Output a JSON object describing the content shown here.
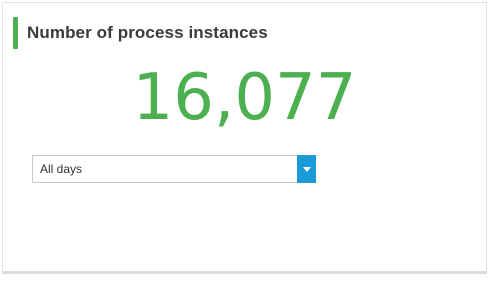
{
  "widget": {
    "title": "Number of process instances",
    "value": "16,077",
    "accent_color": "#4caf50"
  },
  "filter": {
    "selected": "All days",
    "arrow_color": "#1a9ad6",
    "icon": "chevron-down-icon"
  }
}
